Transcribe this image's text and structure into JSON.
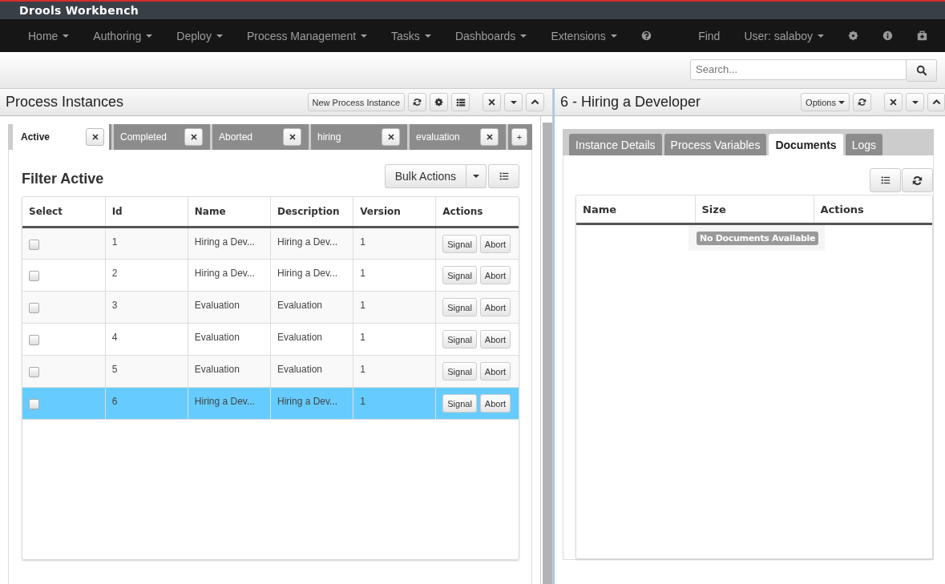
{
  "brand": {
    "title": "Drools Workbench"
  },
  "nav": {
    "items": [
      {
        "label": "Home",
        "kind": "dropdown"
      },
      {
        "label": "Authoring",
        "kind": "dropdown"
      },
      {
        "label": "Deploy",
        "kind": "dropdown"
      },
      {
        "label": "Process Management",
        "kind": "dropdown"
      },
      {
        "label": "Tasks",
        "kind": "dropdown"
      },
      {
        "label": "Dashboards",
        "kind": "dropdown"
      },
      {
        "label": "Extensions",
        "kind": "dropdown"
      },
      {
        "kind": "help"
      }
    ],
    "right_items": [
      {
        "label": "Find",
        "kind": "link"
      },
      {
        "label": "User: salaboy",
        "kind": "dropdown"
      },
      {
        "kind": "settings"
      },
      {
        "kind": "info"
      },
      {
        "kind": "briefcase"
      }
    ]
  },
  "search": {
    "placeholder": "Search..."
  },
  "left_panel": {
    "title": "Process Instances",
    "new_button": "New Process Instance",
    "tabs": [
      {
        "label": "Active",
        "selected": true
      },
      {
        "label": "Completed",
        "selected": false
      },
      {
        "label": "Aborted",
        "selected": false
      },
      {
        "label": "hiring",
        "selected": false
      },
      {
        "label": "evaluation",
        "selected": false
      }
    ],
    "add_tab": "+",
    "filter_title": "Filter Active",
    "bulk_button": "Bulk Actions",
    "table": {
      "columns": [
        "Select",
        "Id",
        "Name",
        "Description",
        "Version",
        "Actions"
      ],
      "rows": [
        {
          "checked": false,
          "selected": false,
          "id": "1",
          "name": "Hiring a Dev...",
          "description": "Hiring a Dev...",
          "version": "1",
          "actions": [
            "Signal",
            "Abort"
          ]
        },
        {
          "checked": false,
          "selected": false,
          "id": "2",
          "name": "Hiring a Dev...",
          "description": "Hiring a Dev...",
          "version": "1",
          "actions": [
            "Signal",
            "Abort"
          ]
        },
        {
          "checked": false,
          "selected": false,
          "id": "3",
          "name": "Evaluation",
          "description": "Evaluation",
          "version": "1",
          "actions": [
            "Signal",
            "Abort"
          ]
        },
        {
          "checked": false,
          "selected": false,
          "id": "4",
          "name": "Evaluation",
          "description": "Evaluation",
          "version": "1",
          "actions": [
            "Signal",
            "Abort"
          ]
        },
        {
          "checked": false,
          "selected": false,
          "id": "5",
          "name": "Evaluation",
          "description": "Evaluation",
          "version": "1",
          "actions": [
            "Signal",
            "Abort"
          ]
        },
        {
          "checked": false,
          "selected": true,
          "id": "6",
          "name": "Hiring a Dev...",
          "description": "Hiring a Dev...",
          "version": "1",
          "actions": [
            "Signal",
            "Abort"
          ]
        }
      ]
    }
  },
  "right_panel": {
    "title": "6 - Hiring a Developer",
    "options_button": "Options",
    "tabs": [
      {
        "label": "Instance Details",
        "selected": false
      },
      {
        "label": "Process Variables",
        "selected": false
      },
      {
        "label": "Documents",
        "selected": true
      },
      {
        "label": "Logs",
        "selected": false
      }
    ],
    "table": {
      "columns": [
        "Name",
        "Size",
        "Actions"
      ],
      "empty_message": "No Documents Available"
    }
  }
}
